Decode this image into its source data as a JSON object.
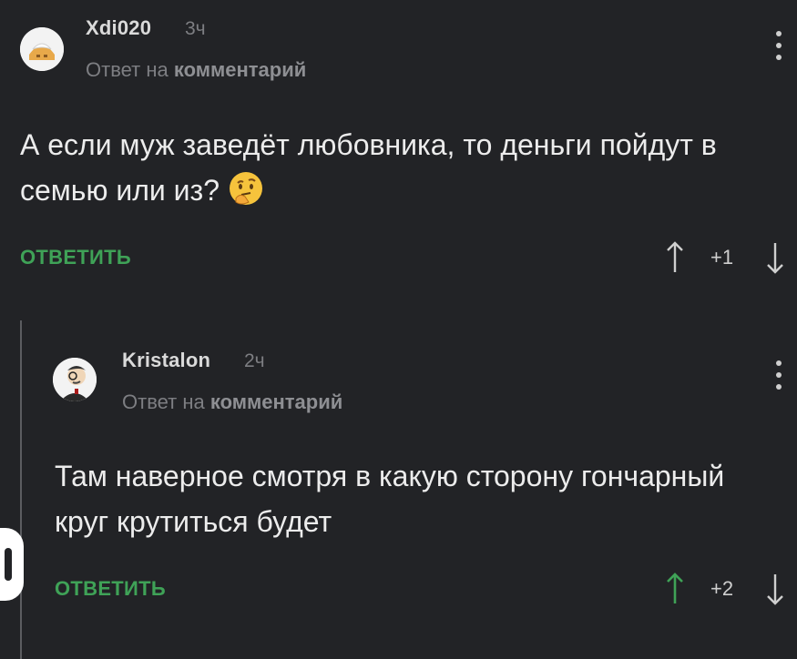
{
  "comments": [
    {
      "username": "Xdi020",
      "time": "3ч",
      "reply_prefix": "Ответ на",
      "reply_target": "комментарий",
      "text": "А если муж заведёт любовника, то деньги пойдут в семью или из?",
      "emoji": "thinking-face",
      "reply_label": "ОТВЕТИТЬ",
      "score": "+1",
      "up_color": "#cfcfcf"
    },
    {
      "username": "Kristalon",
      "time": "2ч",
      "reply_prefix": "Ответ на",
      "reply_target": "комментарий",
      "text": "Там наверное смотря в какую сторону гончарный круг крутиться будет",
      "reply_label": "ОТВЕТИТЬ",
      "score": "+2",
      "up_color": "#3fa257"
    }
  ],
  "colors": {
    "background": "#222326",
    "accent_green": "#3fa257",
    "muted_text": "#7d7e82"
  }
}
